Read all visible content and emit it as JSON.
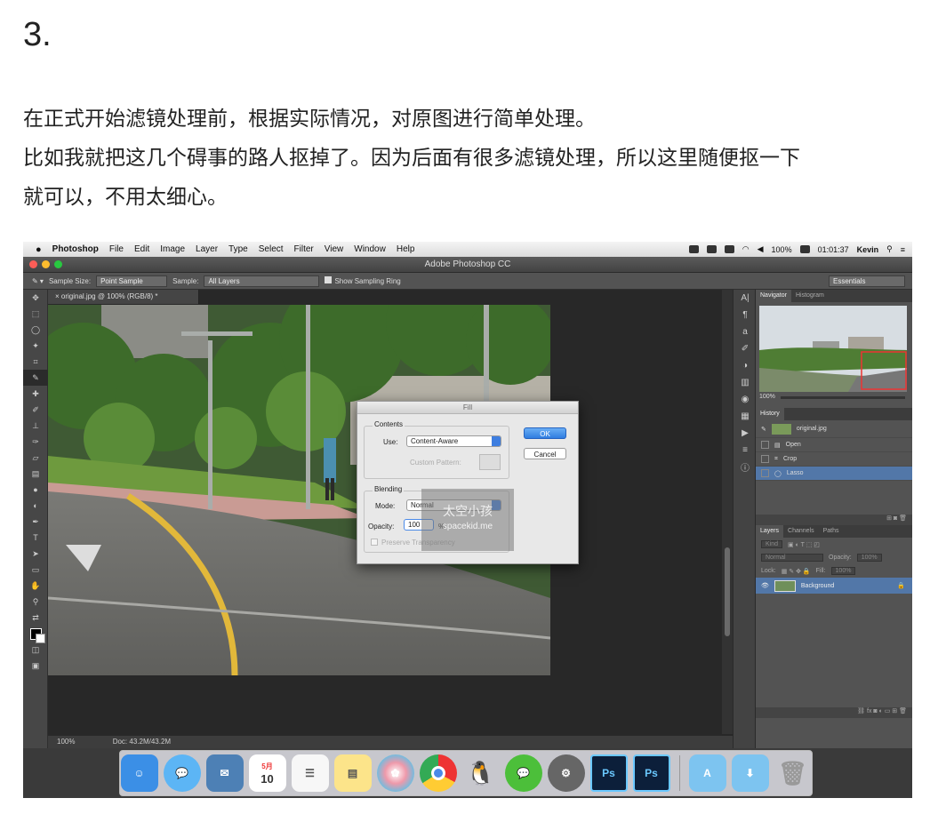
{
  "article": {
    "step_number": "3.",
    "paragraph_line1": "在正式开始滤镜处理前，根据实际情况，对原图进行简单处理。",
    "paragraph_line2": "比如我就把这几个碍事的路人抠掉了。因为后面有很多滤镜处理，所以这里随便抠一下",
    "paragraph_line3": "就可以，不用太细心。"
  },
  "menubar": {
    "apple": "",
    "app_name": "Photoshop",
    "items": [
      "File",
      "Edit",
      "Image",
      "Layer",
      "Type",
      "Select",
      "Filter",
      "View",
      "Window",
      "Help"
    ],
    "battery": "100%",
    "time": "01:01:37",
    "user": "Kevin"
  },
  "window": {
    "title": "Adobe Photoshop CC"
  },
  "options_bar": {
    "sample_size_label": "Sample Size:",
    "sample_size_value": "Point Sample",
    "sample_label": "Sample:",
    "sample_value": "All Layers",
    "show_ring_label": "Show Sampling Ring",
    "workspace": "Essentials"
  },
  "document": {
    "tab_label": "original.jpg @ 100% (RGB/8) *",
    "status_zoom": "100%",
    "status_doc": "Doc: 43.2M/43.2M"
  },
  "fill_dialog": {
    "title": "Fill",
    "contents_label": "Contents",
    "use_label": "Use:",
    "use_value": "Content-Aware",
    "custom_pattern_label": "Custom Pattern:",
    "blending_label": "Blending",
    "mode_label": "Mode:",
    "mode_value": "Normal",
    "opacity_label": "Opacity:",
    "opacity_value": "100",
    "opacity_unit": "%",
    "preserve_label": "Preserve Transparency",
    "ok_label": "OK",
    "cancel_label": "Cancel"
  },
  "watermark": {
    "line1": "太空小孩",
    "line2": "spacekid.me"
  },
  "navigator": {
    "tabs": [
      "Navigator",
      "Histogram"
    ],
    "zoom": "100%"
  },
  "history": {
    "tab": "History",
    "snapshot": "original.jpg",
    "items": [
      "Open",
      "Crop",
      "Lasso"
    ]
  },
  "layers": {
    "tabs": [
      "Layers",
      "Channels",
      "Paths"
    ],
    "kind_label": "Kind",
    "blend_mode": "Normal",
    "opacity_label": "Opacity:",
    "opacity_value": "100%",
    "lock_label": "Lock:",
    "fill_label": "Fill:",
    "fill_value": "100%",
    "layer_name": "Background"
  },
  "dock": {
    "ps_label": "Ps",
    "calendar_month": "5月",
    "calendar_day": "10"
  }
}
